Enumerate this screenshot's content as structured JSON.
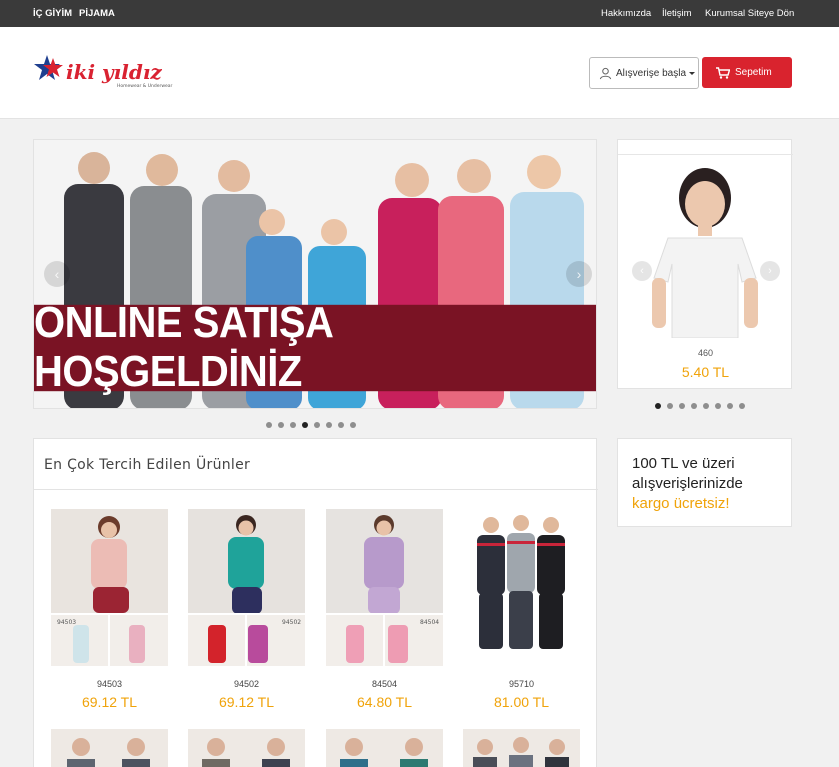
{
  "topbar": {
    "left_links": [
      "İÇ GİYİM",
      "PİJAMA"
    ],
    "right_links": [
      "Hakkımızda",
      "İletişim",
      "Kurumsal Siteye Dön"
    ]
  },
  "header": {
    "logo_text": "iki yıldız",
    "logo_tagline": "Homewear & Underwear",
    "shop_button": "Alışverişe başla",
    "cart_button": "Sepetim"
  },
  "banner": {
    "title": "ONLINE SATIŞA HOŞGELDİNİZ",
    "slide_count": 8,
    "active_slide": 4
  },
  "side_product": {
    "code": "460",
    "price": "5.40 TL",
    "slide_count": 8,
    "active_slide": 1
  },
  "best_sellers": {
    "title": "En Çok Tercih Edilen Ürünler",
    "products": [
      {
        "code": "94503",
        "price": "69.12 TL",
        "color": "#e8b5b0"
      },
      {
        "code": "94502",
        "price": "69.12 TL",
        "color": "#1fa39a"
      },
      {
        "code": "84504",
        "price": "64.80 TL",
        "color": "#b79acb"
      },
      {
        "code": "95710",
        "price": "81.00 TL",
        "color": "#2c2f3a"
      }
    ]
  },
  "promo": {
    "text_main": "100 TL ve üzeri alışverişlerinizde",
    "text_highlight": "kargo ücretsiz!"
  }
}
